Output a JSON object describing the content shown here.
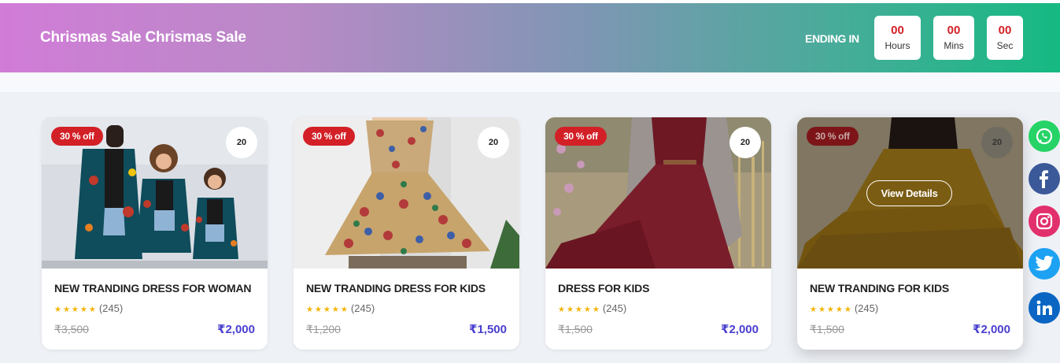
{
  "banner": {
    "title": "Chrismas Sale Chrismas Sale",
    "ending_label": "ENDING IN",
    "timer": [
      {
        "value": "00",
        "label": "Hours"
      },
      {
        "value": "00",
        "label": "Mins"
      },
      {
        "value": "00",
        "label": "Sec"
      }
    ]
  },
  "colors": {
    "gradient_start": "#d17cd7",
    "gradient_end": "#15b982",
    "badge_red": "#d32027",
    "price_blue": "#4a3fcf",
    "star_yellow": "#f5b301"
  },
  "products": [
    {
      "badge": "30 % off",
      "count": "20",
      "name": "NEW TRANDING DRESS FOR WOMAN",
      "stars": "★★★★★",
      "reviews": "(245)",
      "old_price": "₹3,500",
      "new_price": "₹2,000"
    },
    {
      "badge": "30 % off",
      "count": "20",
      "name": "NEW TRANDING DRESS FOR KIDS",
      "stars": "★★★★★",
      "reviews": "(245)",
      "old_price": "₹1,200",
      "new_price": "₹1,500"
    },
    {
      "badge": "30 % off",
      "count": "20",
      "name": "DRESS FOR KIDS",
      "stars": "★★★★★",
      "reviews": "(245)",
      "old_price": "₹1,500",
      "new_price": "₹2,000"
    },
    {
      "badge": "30 % off",
      "count": "20",
      "name": "NEW TRANDING FOR KIDS",
      "stars": "★★★★★",
      "reviews": "(245)",
      "old_price": "₹1,500",
      "new_price": "₹2,000",
      "hover_button": "View Details"
    }
  ],
  "social": [
    {
      "icon": "whatsapp-icon",
      "color": "#25d366"
    },
    {
      "icon": "facebook-icon",
      "color": "#3b5998"
    },
    {
      "icon": "instagram-icon",
      "color": "#e1306c"
    },
    {
      "icon": "twitter-icon",
      "color": "#1da1f2"
    },
    {
      "icon": "linkedin-icon",
      "color": "#0a66c2"
    }
  ]
}
